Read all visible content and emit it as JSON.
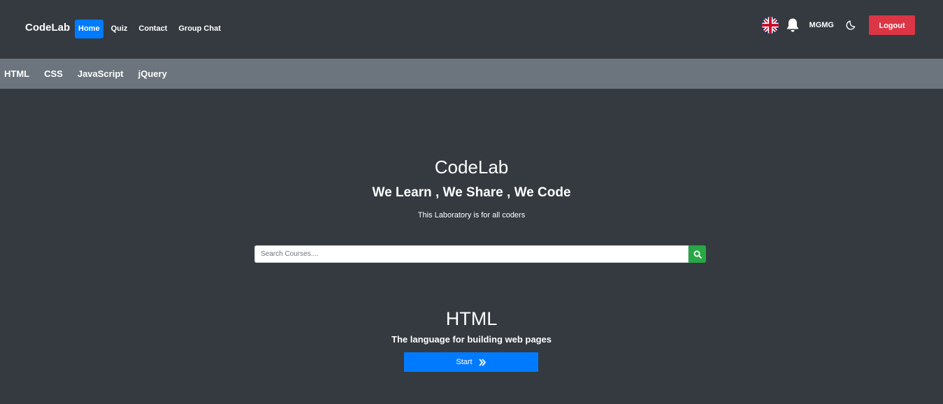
{
  "navbar": {
    "brand": "CodeLab",
    "links": [
      {
        "label": "Home",
        "active": true
      },
      {
        "label": "Quiz",
        "active": false
      },
      {
        "label": "Contact",
        "active": false
      },
      {
        "label": "Group Chat",
        "active": false
      }
    ],
    "language_icon": "uk-flag-icon",
    "notification_icon": "bell-icon",
    "username": "MGMG",
    "theme_icon": "moon-icon",
    "logout_label": "Logout"
  },
  "subnav": {
    "items": [
      "HTML",
      "CSS",
      "JavaScript",
      "jQuery"
    ]
  },
  "hero": {
    "title": "CodeLab",
    "subtitle": "We Learn , We Share , We Code",
    "tagline": "This Laboratory is for all coders"
  },
  "search": {
    "placeholder": "Search Courses....",
    "value": "",
    "button_icon": "search-icon"
  },
  "course": {
    "title": "HTML",
    "description": "The language for building web pages",
    "start_label": "Start",
    "start_icon": "double-chevron-right-icon"
  },
  "colors": {
    "background": "#343a40",
    "subnav_background": "#6c757d",
    "primary": "#007bff",
    "danger": "#dc3545",
    "success": "#28a745"
  }
}
